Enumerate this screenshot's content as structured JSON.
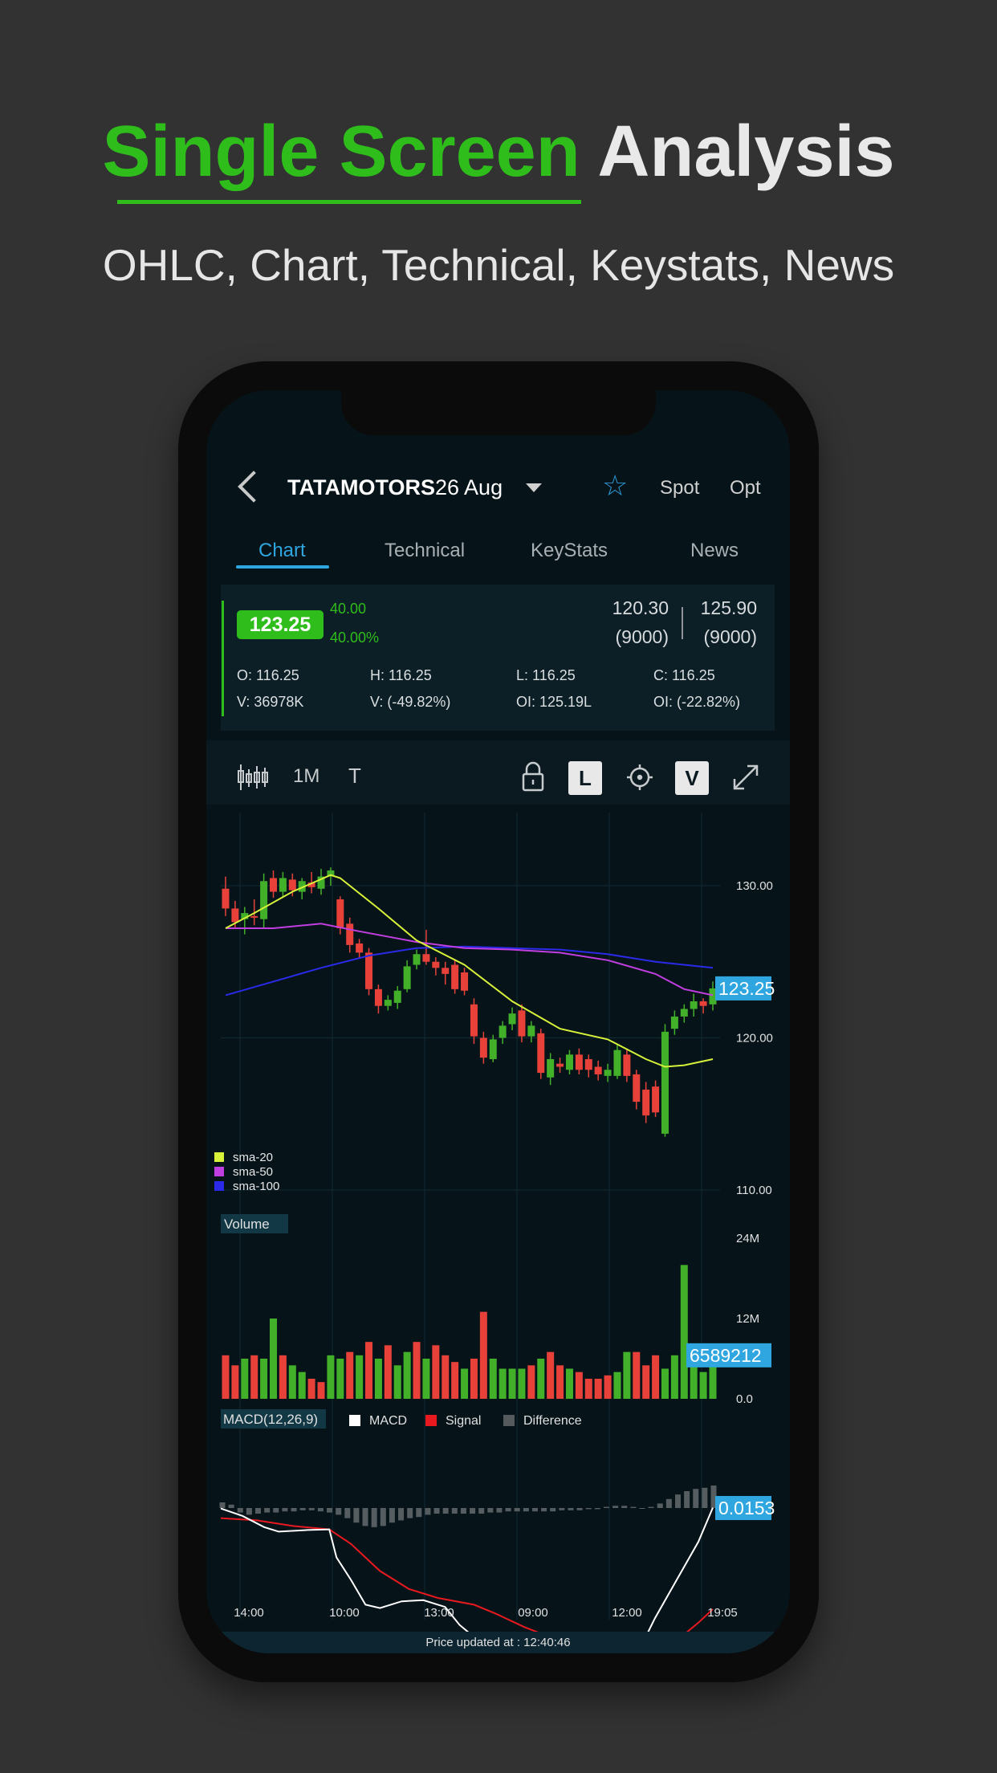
{
  "promo": {
    "title_green": "Single Screen",
    "title_white": "Analysis",
    "subtitle": "OHLC, Chart, Technical, Keystats, News"
  },
  "header": {
    "symbol": "TATAMOTORS",
    "expiry": "26 Aug",
    "spot_label": "Spot",
    "opt_label": "Opt"
  },
  "tabs": [
    {
      "label": "Chart",
      "active": true
    },
    {
      "label": "Technical",
      "active": false
    },
    {
      "label": "KeyStats",
      "active": false
    },
    {
      "label": "News",
      "active": false
    }
  ],
  "quote": {
    "ltp": "123.25",
    "change": "40.00",
    "change_pct": "40.00%",
    "bid": "120.30",
    "bid_qty": "(9000)",
    "ask": "125.90",
    "ask_qty": "(9000)",
    "open": "O: 116.25",
    "high": "H: 116.25",
    "low": "L: 116.25",
    "close": "C: 116.25",
    "volume": "V: 36978K",
    "volume_chg": "V: (-49.82%)",
    "oi": "OI: 125.19L",
    "oi_chg": "OI: (-22.82%)"
  },
  "toolbar": {
    "interval": "1M",
    "text_tool": "T",
    "l_toggle": "L",
    "v_toggle": "V"
  },
  "colors": {
    "up": "#43b02a",
    "down": "#e8413a",
    "accent": "#2fa6df",
    "sma20": "#d8f23a",
    "sma50": "#c13ee0",
    "sma100": "#2a2ae8"
  },
  "chart_data": [
    {
      "type": "candlestick",
      "title": "",
      "y_ticks": [
        "130.00",
        "120.00",
        "110.00"
      ],
      "ylim": [
        110,
        134.8
      ],
      "x_ticks": [
        "14:00",
        "10:00",
        "13:00",
        "09:00",
        "12:00",
        "19:05"
      ],
      "last_price_label": "123.25",
      "legend": [
        {
          "name": "sma-20",
          "color": "#d8f23a"
        },
        {
          "name": "sma-50",
          "color": "#c13ee0"
        },
        {
          "name": "sma-100",
          "color": "#2a2ae8"
        }
      ],
      "candles": [
        {
          "o": 129.8,
          "h": 130.6,
          "l": 128.0,
          "c": 128.5
        },
        {
          "o": 128.5,
          "h": 129.0,
          "l": 127.2,
          "c": 127.6
        },
        {
          "o": 127.8,
          "h": 128.6,
          "l": 126.8,
          "c": 128.2
        },
        {
          "o": 128.0,
          "h": 129.1,
          "l": 127.4,
          "c": 127.9
        },
        {
          "o": 127.8,
          "h": 130.8,
          "l": 127.2,
          "c": 130.3
        },
        {
          "o": 130.5,
          "h": 131.0,
          "l": 129.2,
          "c": 129.6
        },
        {
          "o": 129.6,
          "h": 130.9,
          "l": 129.2,
          "c": 130.5
        },
        {
          "o": 130.4,
          "h": 130.8,
          "l": 129.3,
          "c": 129.7
        },
        {
          "o": 129.6,
          "h": 130.5,
          "l": 129.1,
          "c": 130.3
        },
        {
          "o": 130.2,
          "h": 130.9,
          "l": 129.5,
          "c": 129.9
        },
        {
          "o": 129.8,
          "h": 131.1,
          "l": 129.4,
          "c": 130.6
        },
        {
          "o": 130.6,
          "h": 131.2,
          "l": 130.0,
          "c": 131.0
        },
        {
          "o": 129.1,
          "h": 129.3,
          "l": 126.8,
          "c": 127.2
        },
        {
          "o": 127.5,
          "h": 127.9,
          "l": 125.6,
          "c": 126.1
        },
        {
          "o": 126.2,
          "h": 126.5,
          "l": 125.2,
          "c": 125.6
        },
        {
          "o": 125.6,
          "h": 125.9,
          "l": 122.8,
          "c": 123.2
        },
        {
          "o": 123.2,
          "h": 123.5,
          "l": 121.6,
          "c": 122.1
        },
        {
          "o": 122.1,
          "h": 122.8,
          "l": 121.8,
          "c": 122.5
        },
        {
          "o": 122.3,
          "h": 123.4,
          "l": 121.9,
          "c": 123.1
        },
        {
          "o": 123.2,
          "h": 125.1,
          "l": 123.0,
          "c": 124.7
        },
        {
          "o": 124.8,
          "h": 125.8,
          "l": 124.5,
          "c": 125.5
        },
        {
          "o": 125.5,
          "h": 127.1,
          "l": 124.8,
          "c": 125.0
        },
        {
          "o": 125.0,
          "h": 125.3,
          "l": 124.1,
          "c": 124.6
        },
        {
          "o": 124.6,
          "h": 125.0,
          "l": 123.5,
          "c": 124.2
        },
        {
          "o": 124.8,
          "h": 125.1,
          "l": 122.9,
          "c": 123.2
        },
        {
          "o": 124.3,
          "h": 124.6,
          "l": 122.8,
          "c": 123.1
        },
        {
          "o": 122.2,
          "h": 122.6,
          "l": 119.6,
          "c": 120.1
        },
        {
          "o": 120.0,
          "h": 120.4,
          "l": 118.3,
          "c": 118.7
        },
        {
          "o": 118.6,
          "h": 120.2,
          "l": 118.4,
          "c": 119.9
        },
        {
          "o": 120.0,
          "h": 121.1,
          "l": 119.6,
          "c": 120.8
        },
        {
          "o": 120.9,
          "h": 122.0,
          "l": 120.5,
          "c": 121.6
        },
        {
          "o": 121.8,
          "h": 122.2,
          "l": 119.7,
          "c": 120.1
        },
        {
          "o": 120.1,
          "h": 121.1,
          "l": 119.7,
          "c": 120.8
        },
        {
          "o": 120.3,
          "h": 120.6,
          "l": 117.3,
          "c": 117.7
        },
        {
          "o": 117.4,
          "h": 119.0,
          "l": 116.9,
          "c": 118.6
        },
        {
          "o": 118.3,
          "h": 118.7,
          "l": 117.7,
          "c": 118.1
        },
        {
          "o": 117.9,
          "h": 119.2,
          "l": 117.6,
          "c": 118.9
        },
        {
          "o": 118.9,
          "h": 119.3,
          "l": 117.6,
          "c": 117.9
        },
        {
          "o": 118.6,
          "h": 118.9,
          "l": 117.4,
          "c": 117.9
        },
        {
          "o": 118.1,
          "h": 118.5,
          "l": 117.2,
          "c": 117.6
        },
        {
          "o": 117.5,
          "h": 118.3,
          "l": 117.1,
          "c": 117.9
        },
        {
          "o": 117.5,
          "h": 119.6,
          "l": 117.3,
          "c": 119.2
        },
        {
          "o": 118.9,
          "h": 119.3,
          "l": 117.1,
          "c": 117.5
        },
        {
          "o": 117.6,
          "h": 117.9,
          "l": 115.3,
          "c": 115.8
        },
        {
          "o": 116.6,
          "h": 117.1,
          "l": 114.4,
          "c": 114.9
        },
        {
          "o": 116.8,
          "h": 117.2,
          "l": 114.8,
          "c": 115.1
        },
        {
          "o": 113.7,
          "h": 120.9,
          "l": 113.5,
          "c": 120.4
        },
        {
          "o": 120.6,
          "h": 121.8,
          "l": 120.2,
          "c": 121.4
        },
        {
          "o": 121.4,
          "h": 122.2,
          "l": 121.0,
          "c": 121.9
        },
        {
          "o": 121.9,
          "h": 122.9,
          "l": 121.4,
          "c": 122.4
        },
        {
          "o": 122.4,
          "h": 122.6,
          "l": 121.6,
          "c": 122.1
        },
        {
          "o": 122.2,
          "h": 123.7,
          "l": 121.8,
          "c": 123.25
        }
      ],
      "sma20": [
        [
          0,
          127.2
        ],
        [
          3,
          128.2
        ],
        [
          7,
          129.6
        ],
        [
          11,
          130.7
        ],
        [
          12,
          130.5
        ],
        [
          16,
          128.5
        ],
        [
          20,
          126.4
        ],
        [
          25,
          124.8
        ],
        [
          30,
          122.4
        ],
        [
          35,
          120.6
        ],
        [
          40,
          119.9
        ],
        [
          44,
          118.6
        ],
        [
          46,
          118.1
        ],
        [
          48,
          118.2
        ],
        [
          51,
          118.6
        ]
      ],
      "sma50": [
        [
          0,
          127.2
        ],
        [
          5,
          127.2
        ],
        [
          10,
          127.5
        ],
        [
          14,
          127.0
        ],
        [
          20,
          126.3
        ],
        [
          25,
          125.9
        ],
        [
          30,
          125.8
        ],
        [
          35,
          125.6
        ],
        [
          40,
          125.1
        ],
        [
          45,
          124.2
        ],
        [
          48,
          123.2
        ],
        [
          51,
          122.8
        ]
      ],
      "sma100": [
        [
          0,
          122.8
        ],
        [
          5,
          123.7
        ],
        [
          10,
          124.6
        ],
        [
          15,
          125.4
        ],
        [
          20,
          125.9
        ],
        [
          25,
          126.0
        ],
        [
          30,
          125.9
        ],
        [
          35,
          125.8
        ],
        [
          40,
          125.5
        ],
        [
          45,
          125.0
        ],
        [
          51,
          124.6
        ]
      ]
    },
    {
      "type": "bar",
      "title": "Volume",
      "y_ticks": [
        "24M",
        "12M",
        "0.0"
      ],
      "ylim": [
        0,
        24
      ],
      "last_value_label": "6589212",
      "values": [
        6.5,
        5.0,
        6.0,
        6.5,
        6.0,
        12.0,
        6.5,
        5.0,
        4.0,
        3.0,
        2.5,
        6.5,
        6.0,
        7.0,
        6.5,
        8.5,
        6.0,
        8.0,
        5.0,
        7.0,
        8.5,
        6.0,
        8.0,
        6.5,
        5.5,
        4.5,
        6.0,
        13.0,
        6.0,
        4.5,
        4.5,
        4.5,
        5.0,
        6.0,
        7.0,
        5.0,
        4.5,
        4.0,
        3.0,
        3.0,
        3.5,
        4.0,
        7.0,
        7.0,
        5.0,
        6.5,
        4.5,
        6.5,
        20.0,
        6.0,
        4.0,
        6.5
      ],
      "up": [
        false,
        false,
        true,
        false,
        true,
        true,
        false,
        true,
        true,
        false,
        false,
        true,
        true,
        false,
        true,
        false,
        true,
        false,
        true,
        true,
        false,
        true,
        false,
        false,
        false,
        true,
        false,
        false,
        true,
        true,
        true,
        true,
        false,
        true,
        false,
        false,
        true,
        false,
        false,
        false,
        false,
        true,
        true,
        false,
        false,
        false,
        true,
        true,
        true,
        true,
        true,
        true
      ]
    },
    {
      "type": "line",
      "title": "MACD(12,26,9)",
      "series_names": [
        "MACD",
        "Signal",
        "Difference"
      ],
      "last_value_label": "0.0153",
      "x_ticks": [
        "14:00",
        "10:00",
        "13:00",
        "09:00",
        "12:00",
        "19:05"
      ],
      "macd": [
        [
          0,
          -0.02
        ],
        [
          3,
          -0.35
        ],
        [
          6,
          -0.85
        ],
        [
          8,
          -1.05
        ],
        [
          12,
          -0.98
        ],
        [
          15,
          -0.95
        ],
        [
          16,
          -2.2
        ],
        [
          18,
          -3.2
        ],
        [
          20,
          -4.3
        ],
        [
          22,
          -4.45
        ],
        [
          25,
          -4.15
        ],
        [
          28,
          -4.1
        ],
        [
          31,
          -4.4
        ],
        [
          33,
          -5.2
        ],
        [
          36,
          -6.0
        ],
        [
          38,
          -6.1
        ],
        [
          40,
          -6.3
        ],
        [
          42,
          -6.45
        ],
        [
          45,
          -6.4
        ],
        [
          48,
          -6.3
        ],
        [
          51,
          -6.0
        ],
        [
          53,
          -5.8
        ],
        [
          55,
          -6.15
        ],
        [
          58,
          -6.2
        ],
        [
          60,
          -4.9
        ],
        [
          63,
          -3.2
        ],
        [
          66,
          -1.5
        ],
        [
          68,
          0.0153
        ]
      ],
      "signal": [
        [
          0,
          -0.45
        ],
        [
          5,
          -0.55
        ],
        [
          10,
          -0.8
        ],
        [
          15,
          -0.95
        ],
        [
          18,
          -1.6
        ],
        [
          22,
          -2.8
        ],
        [
          26,
          -3.6
        ],
        [
          30,
          -4.0
        ],
        [
          35,
          -4.3
        ],
        [
          38,
          -4.7
        ],
        [
          42,
          -5.3
        ],
        [
          46,
          -5.8
        ],
        [
          50,
          -6.2
        ],
        [
          54,
          -6.4
        ],
        [
          57,
          -6.4
        ],
        [
          60,
          -6.2
        ],
        [
          63,
          -5.9
        ],
        [
          66,
          -5.1
        ],
        [
          68,
          -4.5
        ]
      ],
      "difference": [
        0.5,
        0.3,
        -0.4,
        -0.6,
        -0.5,
        -0.4,
        -0.4,
        -0.3,
        -0.3,
        -0.2,
        -0.2,
        -0.3,
        -0.4,
        -0.6,
        -0.9,
        -1.3,
        -1.6,
        -1.7,
        -1.6,
        -1.3,
        -1.1,
        -0.9,
        -0.8,
        -0.6,
        -0.5,
        -0.5,
        -0.5,
        -0.5,
        -0.5,
        -0.5,
        -0.4,
        -0.4,
        -0.3,
        -0.3,
        -0.3,
        -0.3,
        -0.3,
        -0.3,
        -0.2,
        -0.2,
        -0.2,
        -0.1,
        -0.1,
        0.1,
        0.2,
        0.2,
        0.1,
        0.0,
        0.1,
        0.4,
        0.8,
        1.2,
        1.5,
        1.7,
        1.8,
        2.0
      ]
    }
  ],
  "axis": {
    "price_updated": "Price updated at : 12:40:46",
    "volume_label": "Volume",
    "macd_label": "MACD(12,26,9)",
    "legend_macd": "MACD",
    "legend_signal": "Signal",
    "legend_difference": "Difference"
  }
}
